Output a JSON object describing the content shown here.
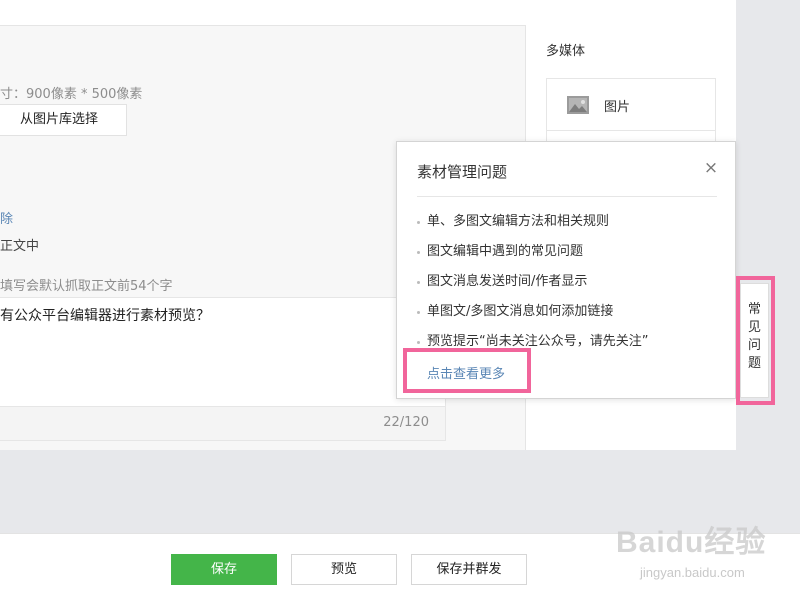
{
  "editor": {
    "cover_size_hint": "寸：900像素 * 500像素",
    "choose_from_library": "从图片库选择",
    "delete_link": "除",
    "in_body_label": "正文中",
    "digest_hint": "填写会默认抓取正文前54个字",
    "digest_text": "有公众平台编辑器进行素材预览？",
    "digest_count": "22/120"
  },
  "media_panel": {
    "title": "多媒体",
    "items": [
      {
        "label": "图片",
        "icon": "image-icon"
      }
    ]
  },
  "faq_popup": {
    "title": "素材管理问题",
    "close_icon": "close-icon",
    "items": [
      "单、多图文编辑方法和相关规则",
      "图文编辑中遇到的常见问题",
      "图文消息发送时间/作者显示",
      "单图文/多图文消息如何添加链接",
      "预览提示“尚未关注公众号，请先关注”"
    ],
    "more_link": "点击查看更多"
  },
  "side_tab": {
    "label": "常见问题"
  },
  "bottom_bar": {
    "save": "保存",
    "preview": "预览",
    "save_and_send": "保存并群发"
  },
  "watermark": {
    "logo": "Baidu经验",
    "url": "jingyan.baidu.com"
  },
  "colors": {
    "primary_green": "#44b549",
    "link_blue": "#5a86b5",
    "highlight_pink": "#f1659b"
  }
}
